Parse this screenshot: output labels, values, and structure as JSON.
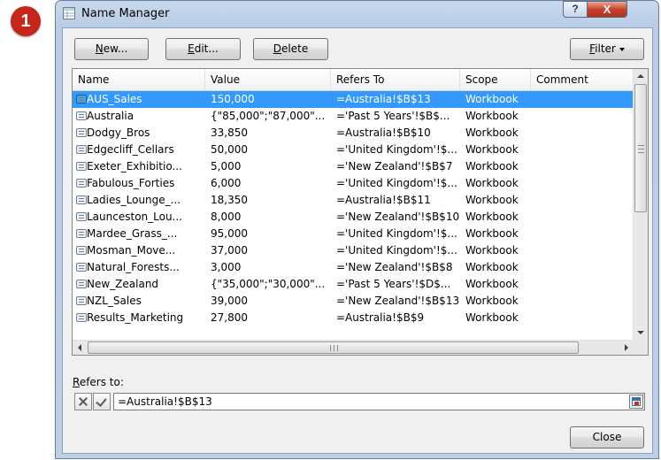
{
  "step_badge": "1",
  "window": {
    "title": "Name Manager",
    "help_glyph": "?",
    "close_glyph": "X"
  },
  "toolbar": {
    "new_underline": "N",
    "new_rest": "ew...",
    "edit_underline": "E",
    "edit_rest": "dit...",
    "delete_underline": "D",
    "delete_rest": "elete",
    "filter_underline": "F",
    "filter_rest": "ilter"
  },
  "columns": [
    "Name",
    "Value",
    "Refers To",
    "Scope",
    "Comment"
  ],
  "rows": [
    {
      "name": "AUS_Sales",
      "value": "150,000",
      "refers_to": "=Australia!$B$13",
      "scope": "Workbook",
      "comment": "",
      "selected": true
    },
    {
      "name": "Australia",
      "value": "{\"85,000\";\"87,000\"...",
      "refers_to": "='Past 5 Years'!$B$...",
      "scope": "Workbook",
      "comment": ""
    },
    {
      "name": "Dodgy_Bros",
      "value": "33,850",
      "refers_to": "=Australia!$B$10",
      "scope": "Workbook",
      "comment": ""
    },
    {
      "name": "Edgecliff_Cellars",
      "value": "50,000",
      "refers_to": "='United Kingdom'!$...",
      "scope": "Workbook",
      "comment": ""
    },
    {
      "name": "Exeter_Exhibitio...",
      "value": "5,000",
      "refers_to": "='New Zealand'!$B$7",
      "scope": "Workbook",
      "comment": ""
    },
    {
      "name": "Fabulous_Forties",
      "value": "6,000",
      "refers_to": "='United Kingdom'!$...",
      "scope": "Workbook",
      "comment": ""
    },
    {
      "name": "Ladies_Lounge_...",
      "value": "18,350",
      "refers_to": "=Australia!$B$11",
      "scope": "Workbook",
      "comment": ""
    },
    {
      "name": "Launceston_Lou...",
      "value": "8,000",
      "refers_to": "='New Zealand'!$B$10",
      "scope": "Workbook",
      "comment": ""
    },
    {
      "name": "Mardee_Grass_...",
      "value": "95,000",
      "refers_to": "='United Kingdom'!$...",
      "scope": "Workbook",
      "comment": ""
    },
    {
      "name": "Mosman_Move...",
      "value": "37,000",
      "refers_to": "='United Kingdom'!$...",
      "scope": "Workbook",
      "comment": ""
    },
    {
      "name": "Natural_Forests...",
      "value": "3,000",
      "refers_to": "='New Zealand'!$B$8",
      "scope": "Workbook",
      "comment": ""
    },
    {
      "name": "New_Zealand",
      "value": "{\"35,000\";\"30,000\"...",
      "refers_to": "='Past 5 Years'!$D$...",
      "scope": "Workbook",
      "comment": ""
    },
    {
      "name": "NZL_Sales",
      "value": "39,000",
      "refers_to": "='New Zealand'!$B$13",
      "scope": "Workbook",
      "comment": ""
    },
    {
      "name": "Results_Marketing",
      "value": "27,800",
      "refers_to": "=Australia!$B$9",
      "scope": "Workbook",
      "comment": ""
    }
  ],
  "refers_to": {
    "label_underline": "R",
    "label_rest": "efers to:",
    "value": "=Australia!$B$13"
  },
  "footer": {
    "close_label": "Close"
  },
  "colors": {
    "selection": "#3399ff",
    "badge": "#c8251a",
    "close_button": "#c7442c"
  }
}
